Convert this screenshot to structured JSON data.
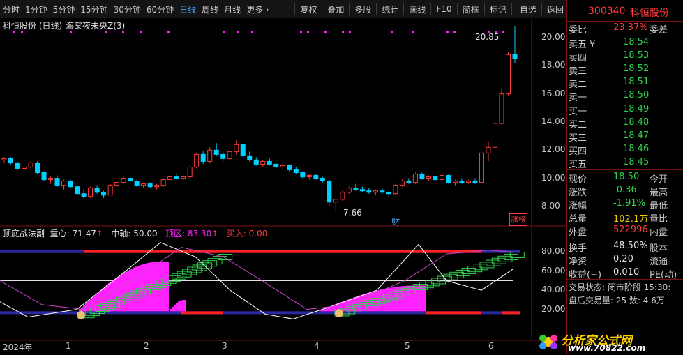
{
  "toolbar": {
    "items": [
      "分时",
      "1分钟",
      "5分钟",
      "15分钟",
      "30分钟",
      "60分钟",
      "日线",
      "周线",
      "月线",
      "更多 ›"
    ],
    "active": "日线",
    "right_items": [
      "复权",
      "叠加",
      "多股",
      "统计",
      "画线",
      "F10",
      "简框",
      "标记",
      "-自选",
      "返回"
    ]
  },
  "main_chart": {
    "title": "科恒股份 (日线)",
    "indicator": "海棠夜未央Z(3)",
    "high_label": "20.85",
    "low_label": "7.66",
    "badge": "涨榜",
    "caiwu": "财",
    "y_ticks": [
      "20.00",
      "18.00",
      "16.00",
      "14.00",
      "12.00",
      "10.00",
      "8.00"
    ]
  },
  "sub_chart": {
    "name": "顶底战法副",
    "zhongxin": "重心: 71.47",
    "zhongzhou": "中轴: 50.00",
    "dingqu": "顶区: 83.30",
    "mairu": "买入: 0.00",
    "y_ticks": [
      "80.00",
      "60.00",
      "40.00",
      "20.00"
    ]
  },
  "x_axis": {
    "labels": [
      "2024年",
      "1",
      "2",
      "3",
      "4",
      "5",
      "6"
    ]
  },
  "colors": {
    "up": "#ff3b3b",
    "down": "#00d0ff",
    "magenta": "#ff22ff",
    "green": "#2fd04c"
  },
  "quote": {
    "code": "300340",
    "name": "科恒股份",
    "weibi_label": "委比",
    "weibi": "23.37%",
    "weicha_label": "委差",
    "sell": [
      {
        "label": "卖五 ¥",
        "price": "18.54"
      },
      {
        "label": "卖四",
        "price": "18.53"
      },
      {
        "label": "卖三",
        "price": "18.52"
      },
      {
        "label": "卖二",
        "price": "18.51"
      },
      {
        "label": "卖一",
        "price": "18.50"
      }
    ],
    "buy": [
      {
        "label": "买一",
        "price": "18.49"
      },
      {
        "label": "买二",
        "price": "18.48"
      },
      {
        "label": "买三",
        "price": "18.47"
      },
      {
        "label": "买四",
        "price": "18.46"
      },
      {
        "label": "买五",
        "price": "18.45"
      }
    ],
    "stats": [
      {
        "l": "现价",
        "v": "18.50",
        "r": "今开",
        "vc": "green"
      },
      {
        "l": "涨跌",
        "v": "-0.36",
        "r": "最高",
        "vc": "green"
      },
      {
        "l": "涨幅",
        "v": "-1.91%",
        "r": "最低",
        "vc": "green"
      },
      {
        "l": "总量",
        "v": "102.1万",
        "r": "量比",
        "vc": "yellow"
      },
      {
        "l": "外盘",
        "v": "522996",
        "r": "内盘",
        "vc": "red"
      },
      {
        "l": "换手",
        "v": "48.50%",
        "r": "股本",
        "vc": "white"
      },
      {
        "l": "净资",
        "v": "0.20",
        "r": "流通",
        "vc": "white"
      },
      {
        "l": "收益(−)",
        "v": "0.010",
        "r": "PE(动)",
        "vc": "white"
      }
    ],
    "status": "交易状态: 闭市阶段 15:30:",
    "after": "盘后交易量: 25  数: 4.6万",
    "watermark_cn": "分析家公式网",
    "watermark_url": "www.70822.com"
  },
  "chart_data": {
    "type": "candlestick",
    "price_range": [
      7.0,
      21.0
    ],
    "ohlc": [
      [
        11.3,
        11.5,
        11.1,
        11.4
      ],
      [
        11.4,
        11.5,
        11.0,
        11.1
      ],
      [
        11.1,
        11.2,
        10.6,
        10.7
      ],
      [
        10.7,
        10.9,
        10.5,
        10.8
      ],
      [
        10.8,
        11.2,
        10.7,
        11.1
      ],
      [
        11.1,
        11.2,
        10.3,
        10.4
      ],
      [
        10.4,
        10.5,
        9.8,
        9.9
      ],
      [
        9.9,
        10.1,
        9.6,
        10.0
      ],
      [
        10.0,
        10.2,
        9.4,
        9.5
      ],
      [
        9.5,
        9.9,
        9.2,
        9.8
      ],
      [
        9.8,
        9.9,
        9.3,
        9.4
      ],
      [
        9.4,
        9.5,
        8.7,
        8.9
      ],
      [
        8.9,
        9.2,
        8.5,
        8.7
      ],
      [
        8.7,
        9.4,
        8.6,
        9.3
      ],
      [
        9.3,
        9.5,
        8.9,
        9.0
      ],
      [
        9.0,
        9.1,
        8.6,
        8.8
      ],
      [
        8.8,
        9.6,
        8.8,
        9.5
      ],
      [
        9.5,
        9.8,
        9.3,
        9.7
      ],
      [
        9.7,
        10.1,
        9.6,
        10.0
      ],
      [
        10.0,
        10.2,
        9.7,
        9.8
      ],
      [
        9.8,
        9.9,
        9.4,
        9.5
      ],
      [
        9.5,
        9.7,
        9.3,
        9.6
      ],
      [
        9.6,
        9.7,
        9.3,
        9.4
      ],
      [
        9.4,
        9.6,
        9.2,
        9.5
      ],
      [
        9.5,
        10.0,
        9.4,
        9.9
      ],
      [
        9.9,
        10.2,
        9.8,
        10.1
      ],
      [
        10.1,
        10.3,
        9.9,
        10.0
      ],
      [
        10.0,
        10.2,
        9.8,
        10.1
      ],
      [
        10.1,
        10.9,
        10.0,
        10.8
      ],
      [
        10.8,
        11.8,
        10.7,
        11.7
      ],
      [
        11.7,
        11.9,
        11.0,
        11.2
      ],
      [
        11.2,
        12.2,
        11.1,
        12.0
      ],
      [
        12.0,
        12.5,
        11.6,
        11.7
      ],
      [
        11.7,
        11.9,
        11.2,
        11.4
      ],
      [
        11.4,
        12.0,
        11.3,
        11.9
      ],
      [
        11.9,
        12.7,
        11.7,
        12.4
      ],
      [
        12.4,
        12.5,
        11.5,
        11.6
      ],
      [
        11.6,
        11.9,
        11.2,
        11.3
      ],
      [
        11.3,
        11.5,
        10.9,
        11.0
      ],
      [
        11.0,
        11.3,
        10.8,
        11.2
      ],
      [
        11.2,
        11.4,
        10.9,
        11.0
      ],
      [
        11.0,
        11.1,
        10.7,
        10.8
      ],
      [
        10.8,
        11.0,
        10.6,
        10.9
      ],
      [
        10.9,
        11.0,
        10.5,
        10.6
      ],
      [
        10.6,
        10.8,
        10.3,
        10.4
      ],
      [
        10.4,
        10.5,
        10.0,
        10.1
      ],
      [
        10.1,
        10.3,
        9.9,
        10.2
      ],
      [
        10.2,
        10.3,
        9.9,
        10.0
      ],
      [
        10.0,
        10.1,
        9.7,
        9.8
      ],
      [
        9.8,
        9.9,
        8.0,
        8.3
      ],
      [
        8.3,
        8.6,
        7.66,
        8.5
      ],
      [
        8.5,
        9.1,
        8.4,
        9.0
      ],
      [
        9.0,
        9.4,
        8.9,
        9.3
      ],
      [
        9.3,
        9.6,
        9.1,
        9.2
      ],
      [
        9.2,
        9.4,
        9.0,
        9.1
      ],
      [
        9.1,
        9.3,
        8.9,
        9.0
      ],
      [
        9.0,
        9.2,
        8.8,
        9.1
      ],
      [
        9.1,
        9.3,
        8.9,
        9.0
      ],
      [
        9.0,
        9.1,
        8.7,
        8.9
      ],
      [
        8.9,
        9.6,
        8.8,
        9.5
      ],
      [
        9.5,
        9.9,
        9.4,
        9.8
      ],
      [
        9.8,
        10.0,
        9.6,
        9.7
      ],
      [
        9.7,
        10.4,
        9.6,
        10.3
      ],
      [
        10.3,
        10.4,
        9.9,
        10.0
      ],
      [
        10.0,
        10.2,
        9.8,
        10.1
      ],
      [
        10.1,
        10.2,
        9.8,
        9.9
      ],
      [
        9.9,
        10.3,
        9.8,
        10.2
      ],
      [
        10.2,
        10.3,
        9.6,
        9.7
      ],
      [
        9.7,
        9.9,
        9.5,
        9.8
      ],
      [
        9.8,
        10.0,
        9.6,
        9.7
      ],
      [
        9.7,
        9.9,
        9.6,
        9.8
      ],
      [
        9.8,
        10.0,
        9.6,
        9.7
      ],
      [
        9.7,
        11.8,
        9.7,
        11.8
      ],
      [
        11.8,
        12.6,
        11.2,
        12.2
      ],
      [
        12.2,
        14.0,
        12.0,
        13.9
      ],
      [
        13.9,
        16.4,
        13.8,
        16.0
      ],
      [
        16.0,
        19.0,
        15.9,
        18.8
      ],
      [
        18.8,
        20.85,
        18.2,
        18.5
      ]
    ]
  }
}
